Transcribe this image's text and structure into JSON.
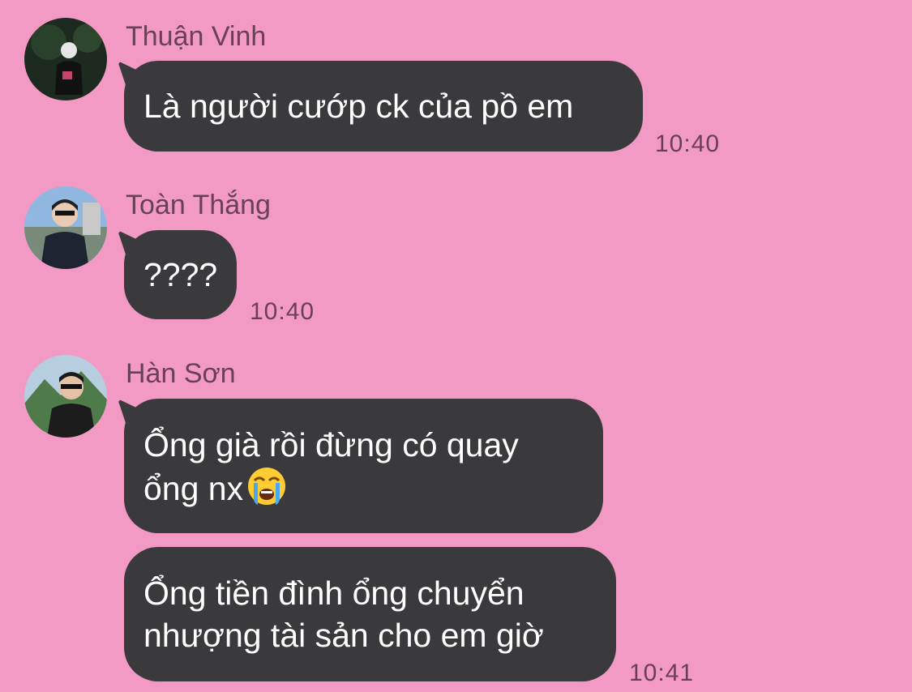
{
  "messages": [
    {
      "sender": "Thuận Vinh",
      "avatar": "avatar-thuan-vinh",
      "bubbles": [
        {
          "lines": [
            "Là người cướp ck của pồ em"
          ]
        }
      ],
      "time": "10:40"
    },
    {
      "sender": "Toàn Thắng",
      "avatar": "avatar-toan-thang",
      "bubbles": [
        {
          "lines": [
            "????"
          ]
        }
      ],
      "time": "10:40"
    },
    {
      "sender": "Hàn Sơn",
      "avatar": "avatar-han-son",
      "bubbles": [
        {
          "lines": [
            "Ổng già rồi đừng có quay",
            "ổng nx"
          ],
          "emoji": "loudly-crying-face"
        },
        {
          "lines": [
            "Ổng tiền đình ổng chuyển",
            "nhượng tài sản cho em giờ"
          ]
        }
      ],
      "time": "10:41"
    }
  ],
  "colors": {
    "background": "#f29ac4",
    "bubble": "#3a3a3c",
    "bubble_text": "#ffffff",
    "meta_text": "#6a4154"
  }
}
